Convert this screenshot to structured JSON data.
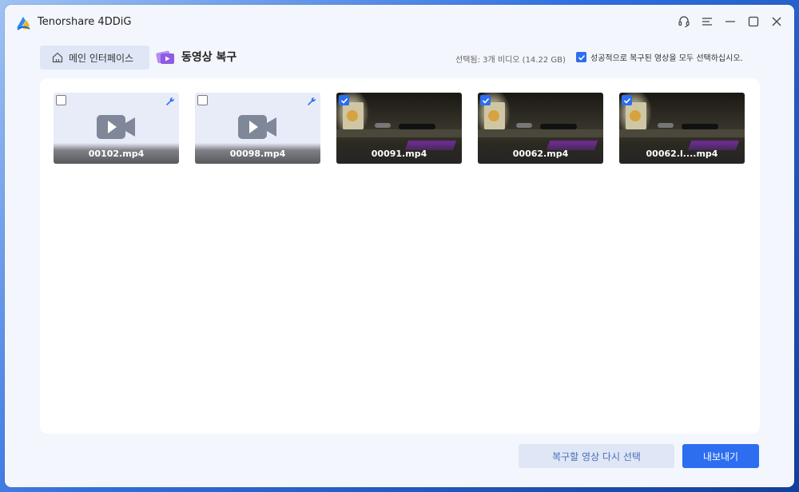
{
  "app": {
    "title": "Tenorshare 4DDiG"
  },
  "nav": {
    "home_label": "메인 인터페이스",
    "section_label": "동영상 복구"
  },
  "selection": {
    "info": "선택됨: 3개 비디오 (14.22 GB)",
    "select_all_label": "성공적으로 복구된 영상을 모두 선택하십시오.",
    "select_all_checked": true
  },
  "videos": [
    {
      "name": "00102.mp4",
      "checked": false,
      "repaired": false
    },
    {
      "name": "00098.mp4",
      "checked": false,
      "repaired": false
    },
    {
      "name": "00091.mp4",
      "checked": true,
      "repaired": true
    },
    {
      "name": "00062.mp4",
      "checked": true,
      "repaired": true
    },
    {
      "name": "00062.l....mp4",
      "checked": true,
      "repaired": true
    }
  ],
  "buttons": {
    "reselect_label": "복구할 영상 다시 선택",
    "export_label": "내보내기"
  },
  "icons": {
    "logo": "tenorshare-logo-icon",
    "support": "headset-icon",
    "menu": "menu-icon",
    "minimize": "minimize-icon",
    "maximize": "maximize-icon",
    "close": "close-icon",
    "home": "home-icon",
    "section": "video-repair-icon",
    "video": "video-camera-icon",
    "wrench": "wrench-icon",
    "check": "checkmark-icon"
  },
  "colors": {
    "accent": "#2d6df0",
    "panel": "#ffffff",
    "window": "#f3f6fc",
    "broken_card": "#e8ecf9"
  }
}
